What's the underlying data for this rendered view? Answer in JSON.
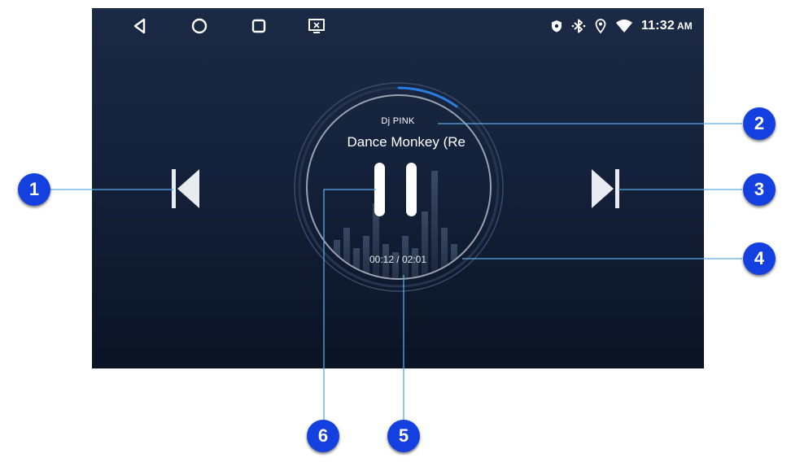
{
  "status_bar": {
    "nav": {
      "back_icon": "triangle-back-icon",
      "home_icon": "circle-home-icon",
      "recents_icon": "square-recents-icon",
      "screen_icon": "screen-cast-icon"
    },
    "icons": [
      "shield-icon",
      "bluetooth-icon",
      "location-icon",
      "wifi-icon"
    ],
    "time": "11:32",
    "ampm": "AM"
  },
  "player": {
    "artist": "Dj PINK",
    "title": "Dance Monkey (Re",
    "elapsed_time": "00:12 / 02:01",
    "progress_fraction": 0.099,
    "buttons": {
      "previous_icon": "skip-previous-icon",
      "pause_icon": "pause-icon",
      "next_icon": "skip-next-icon"
    }
  },
  "callouts": [
    "1",
    "2",
    "3",
    "4",
    "5",
    "6"
  ],
  "colors": {
    "background_top": "#1b2a45",
    "background_bottom": "#0b1424",
    "progress_arc": "#2b7de0",
    "callout_fill": "#1440e0",
    "leader_line": "#5aa9e6"
  }
}
